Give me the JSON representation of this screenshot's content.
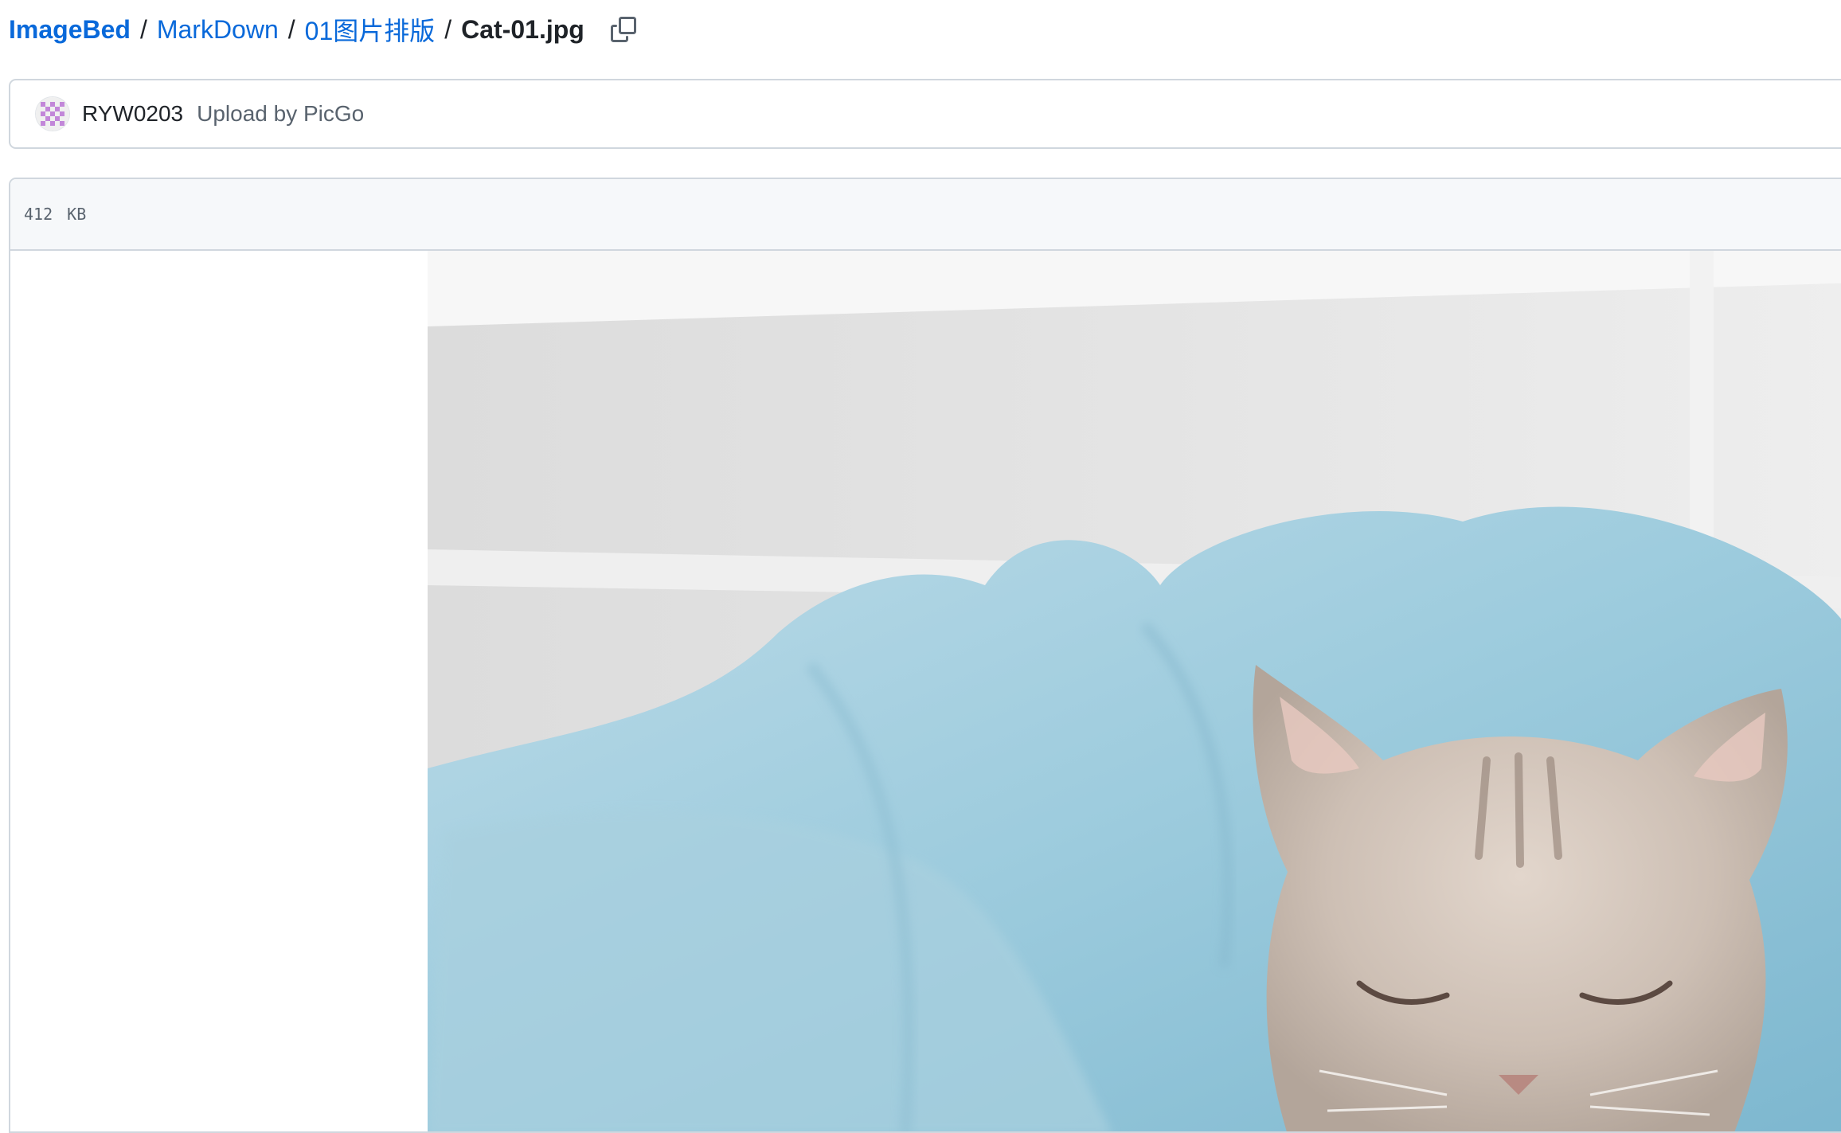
{
  "breadcrumb": {
    "root": "ImageBed",
    "folders": [
      "MarkDown",
      "01图片排版"
    ],
    "separator": "/",
    "current_file": "Cat-01.jpg",
    "copy_icon": "copy-icon"
  },
  "commit": {
    "avatar_icon": "identicon-avatar",
    "author": "RYW0203",
    "message": "Upload by PicGo"
  },
  "file": {
    "size": "412 KB",
    "preview_alt": "Cat-01.jpg"
  },
  "colors": {
    "link": "#0969da",
    "text": "#1f2328",
    "muted": "#59636e",
    "border": "#d0d7de",
    "header_bg": "#f6f8fa",
    "avatar_accent": "#c287d9"
  }
}
